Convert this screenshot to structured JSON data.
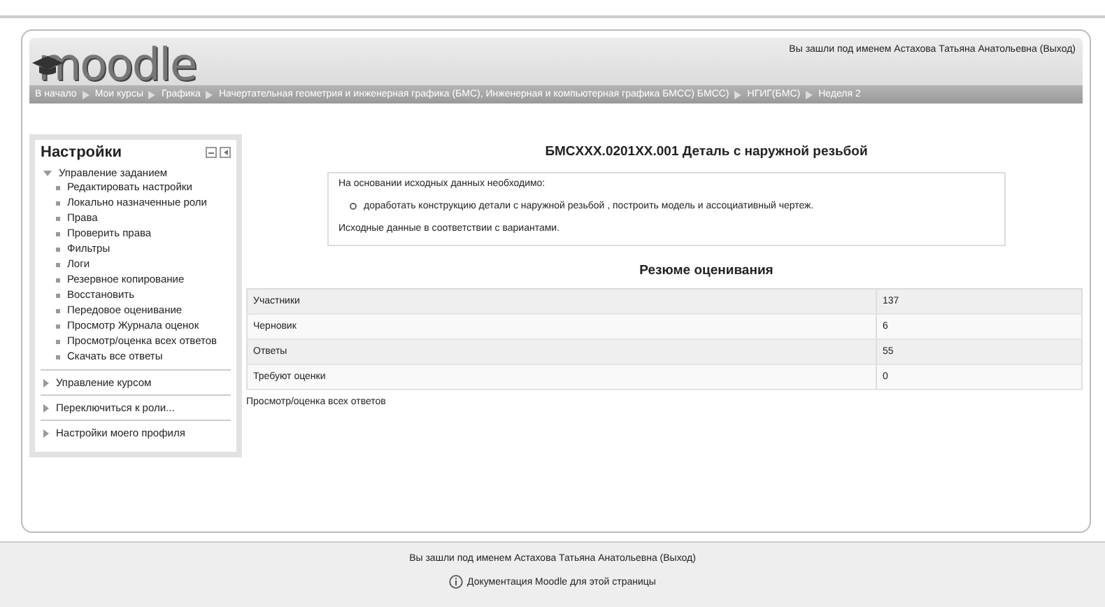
{
  "header": {
    "logo": "moodle",
    "login_info": "Вы зашли под именем Астахова Татьяна Анатольевна (Выход)"
  },
  "breadcrumb": [
    {
      "label": "В начало"
    },
    {
      "label": "Мои курсы"
    },
    {
      "label": "Графика"
    },
    {
      "label": "Начертательная геометрия и инженерная графика (БМС), Инженерная и компьютерная графика БМСС) БМСС)"
    },
    {
      "label": "НГИГ(БМС)"
    },
    {
      "label": "Неделя 2"
    }
  ],
  "settings_block": {
    "title": "Настройки",
    "sections": [
      {
        "label": "Управление заданием",
        "expanded": true,
        "children": [
          {
            "label": "Редактировать настройки"
          },
          {
            "label": "Локально назначенные роли"
          },
          {
            "label": "Права"
          },
          {
            "label": "Проверить права"
          },
          {
            "label": "Фильтры"
          },
          {
            "label": "Логи"
          },
          {
            "label": "Резервное копирование"
          },
          {
            "label": "Восстановить"
          },
          {
            "label": "Передовое оценивание"
          },
          {
            "label": "Просмотр Журнала оценок"
          },
          {
            "label": "Просмотр/оценка всех ответов"
          },
          {
            "label": "Скачать все ответы"
          }
        ]
      },
      {
        "label": "Управление курсом",
        "expanded": false
      },
      {
        "label": "Переключиться к роли...",
        "expanded": false
      },
      {
        "label": "Настройки моего профиля",
        "expanded": false
      }
    ]
  },
  "assignment": {
    "title": "БМСXXX.0201XX.001 Деталь с наружной резьбой",
    "intro": "На основании исходных данных необходимо:",
    "bullets": [
      "доработать конструкцию детали с наружной резьбой , построить модель и ассоциативный чертеж."
    ],
    "note": "Исходные данные в соответствии с вариантами."
  },
  "grading_summary": {
    "title": "Резюме оценивания",
    "rows": [
      {
        "label": "Участники",
        "value": "137"
      },
      {
        "label": "Черновик",
        "value": "6"
      },
      {
        "label": "Ответы",
        "value": "55"
      },
      {
        "label": "Требуют оценки",
        "value": "0"
      }
    ],
    "link": "Просмотр/оценка всех ответов"
  },
  "footer": {
    "login_info": "Вы зашли под именем Астахова Татьяна Анатольевна (Выход)",
    "doc_link": "Документация Moodle для этой страницы"
  }
}
